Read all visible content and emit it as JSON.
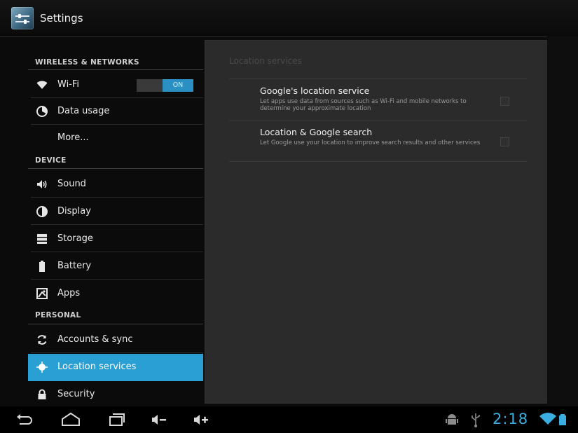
{
  "app": {
    "title": "Settings"
  },
  "sections": {
    "wireless": "WIRELESS & NETWORKS",
    "device": "DEVICE",
    "personal": "PERSONAL"
  },
  "left_items": {
    "wifi": {
      "label": "Wi-Fi",
      "icon": "wifi-icon",
      "toggle": "ON"
    },
    "data_usage": {
      "label": "Data usage",
      "icon": "data-usage-icon"
    },
    "more": {
      "label": "More..."
    },
    "sound": {
      "label": "Sound",
      "icon": "speaker-icon"
    },
    "display": {
      "label": "Display",
      "icon": "brightness-icon"
    },
    "storage": {
      "label": "Storage",
      "icon": "storage-icon"
    },
    "battery": {
      "label": "Battery",
      "icon": "battery-icon"
    },
    "apps": {
      "label": "Apps",
      "icon": "apps-icon"
    },
    "accounts": {
      "label": "Accounts & sync",
      "icon": "sync-icon"
    },
    "location": {
      "label": "Location services",
      "icon": "location-icon",
      "selected": true
    },
    "security": {
      "label": "Security",
      "icon": "lock-icon"
    }
  },
  "detail": {
    "title": "Location services",
    "prefs": [
      {
        "title": "Google's location service",
        "summary": "Let apps use data from sources such as Wi-Fi and mobile networks to determine your approximate location",
        "checked": false
      },
      {
        "title": "Location & Google search",
        "summary": "Let Google use your location to improve search results and other services",
        "checked": false
      }
    ]
  },
  "status": {
    "time": "2:18",
    "icons": [
      "back-icon",
      "home-icon",
      "recent-apps-icon",
      "volume-down-icon",
      "volume-up-icon",
      "android-debug-icon",
      "usb-icon",
      "wifi-signal-icon",
      "battery-status-icon"
    ]
  },
  "colors": {
    "accent": "#2a9fd4",
    "clock": "#3aaee0"
  }
}
